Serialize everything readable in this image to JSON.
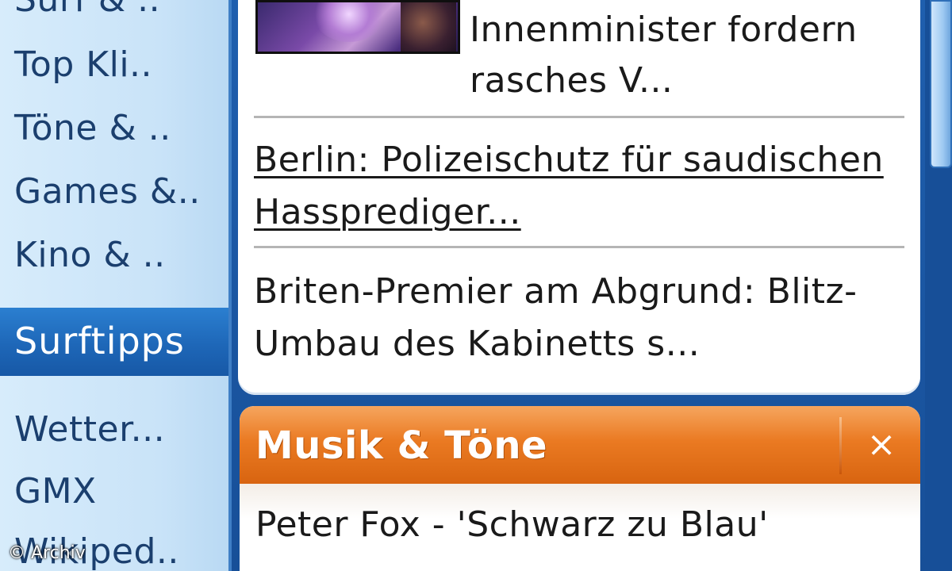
{
  "sidebar": {
    "items_top": [
      {
        "label": "Surf & .."
      },
      {
        "label": "Top Kli.."
      },
      {
        "label": "Töne & .."
      },
      {
        "label": "Games &.."
      },
      {
        "label": "Kino & .."
      }
    ],
    "section_label": "Surftipps",
    "items_bottom": [
      {
        "label": "Wetter..."
      },
      {
        "label": "GMX"
      },
      {
        "label": "Wikiped.."
      }
    ]
  },
  "credit": "© Archiv",
  "news": {
    "lead_text_line1": "Innenminister fordern",
    "lead_text_line2": "rasches V...",
    "items": [
      {
        "line1": "Berlin: Polizeischutz für saudischen",
        "line2": "Hassprediger..."
      },
      {
        "line1": "Briten-Premier am Abgrund: Blitz-",
        "line2": "Umbau des Kabinetts s..."
      }
    ]
  },
  "music": {
    "title": "Musik & Töne",
    "close_symbol": "×",
    "items": [
      {
        "label": "Peter Fox - 'Schwarz zu Blau'"
      }
    ]
  },
  "colors": {
    "sidebar_bg": "#c9e3f8",
    "sidebar_selected": "#1e67b8",
    "frame_blue": "#1a4f96",
    "music_header_orange": "#ea7a22"
  },
  "icons": {
    "close": "close-icon"
  }
}
